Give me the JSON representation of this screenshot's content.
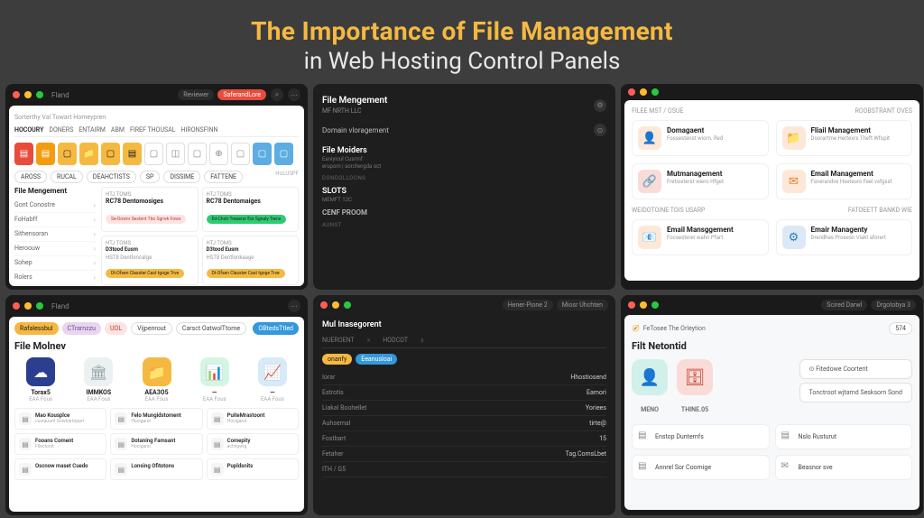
{
  "hero": {
    "title": "The Importance of File Management",
    "subtitle": "in Web Hosting Control Panels"
  },
  "p1": {
    "wintitle": "Fland",
    "btn1": "Reviewer",
    "btn2": "SaferandLore",
    "crumb": "Sorterthy Val Towart Homeypren",
    "tabs": [
      "HOCOURY",
      "DONERS",
      "ENTAIRM",
      "ABM",
      "FIREF THOUSAL",
      "HIRONSFINN"
    ],
    "filters": [
      "AROSS",
      "RUCAL",
      "DEAHCTISTS",
      "SP",
      "DISSIME",
      "FATTENE"
    ],
    "filter_r": "HULUSPF",
    "side_title": "File Mengement",
    "side_items": [
      "Gont Conostre",
      "FoHabff",
      "Sithensoran",
      "Heroouw",
      "Sohep",
      "Rolers"
    ],
    "cards": [
      {
        "t": "HTJ TOMS",
        "h": "RC78 Dentomosiges",
        "b": "Se-Downr Sestent Tbo Sgrwk Fows"
      },
      {
        "t": "HTJ TOMS",
        "h": "RC78 Dentomaiges",
        "b": "Ed-Chstr Treserur Eor Sgnaly Trens"
      },
      {
        "t": "HTJ TOMS",
        "h": "D3tood Eusm",
        "b": "Dt-Ofsen Classter Cast tgoge Trve",
        "s": "HST8 Dentloncalge"
      },
      {
        "t": "HTJ TOMS",
        "h": "D3tood Eusm",
        "b": "Dt-Ofsen Classter Cast tgoge Trve",
        "s": "HST8 Dentlonkaage"
      }
    ]
  },
  "p2": {
    "title": "File Mengement",
    "sub1": "MF NRTH LLC",
    "item1": "Domain vloragement",
    "sec": {
      "title": "File Moiders",
      "sub": "Eaniyicul Cusrmf",
      "sub2": "eruporn | sorchergda oct"
    },
    "div1": "DONDOLLOONS",
    "s2": "SLOTS",
    "s2s": "MEMFT 12C",
    "div2": "CENF PROOM",
    "s3": "AUNST"
  },
  "p3": {
    "hdr_l": "FILEE MST / OSUE",
    "hdr_r": "ROOBSTRANT OVES",
    "hdr_m": "WEIDOTOINE TOIS USARP",
    "hdr_m2": "FATOEETT BANKD WIE",
    "cards": [
      {
        "i": "or",
        "t": "Domagaent",
        "s": "Fossestenst wiorn. Red"
      },
      {
        "i": "or",
        "t": "Fliail Management",
        "s": "Doorartme Hertexrs Theft Wfopit"
      },
      {
        "i": "pk",
        "t": "Mutmanagement",
        "s": "Fretiosterst wiero Hfget"
      },
      {
        "i": "or",
        "t": "Email Management",
        "s": "Fsnerandve Hseteurs Feel vsfgsst"
      },
      {
        "i": "or",
        "t": "Email Mansggement",
        "s": "Focsesterer wahn Pfart"
      },
      {
        "i": "bl",
        "t": "Emair Managenty",
        "s": "Drendhes Prosesn Viakt aforert"
      }
    ]
  },
  "p4": {
    "wintitle": "Fland",
    "chips": [
      "Rafalessbul",
      "CTrarnzzu",
      "UOL",
      "Vijpenrout",
      "Carsct OatwolTtome"
    ],
    "chip_r": "OBtedsTtled",
    "title": "File Molnev",
    "big": [
      {
        "i": "bl",
        "t": "Torax5",
        "s": "EAA Fous"
      },
      {
        "i": "gy",
        "t": "IMMKOS",
        "s": "EAA Fous"
      },
      {
        "i": "yl",
        "t": "AEA3O5",
        "s": "EAA Fous"
      },
      {
        "i": "gn",
        "t": "—",
        "s": "EAA Fous"
      },
      {
        "i": "lb",
        "t": "—",
        "s": "EAA Fous"
      }
    ],
    "small": [
      {
        "t": "Mao Kousplce",
        "s": "custauarit Gowhartopart"
      },
      {
        "t": "Felo Mungidstoment",
        "s": "Hocigarst"
      },
      {
        "t": "PuiteMrastoont",
        "s": "Hocigarst"
      },
      {
        "t": "Fooans Coment",
        "s": "Filectorst"
      },
      {
        "t": "Dotaning Famsant",
        "s": "Hocigarst"
      },
      {
        "t": "Comepity",
        "s": "actvigwrg"
      },
      {
        "t": "Oscnow maset Cuedo",
        "s": ""
      },
      {
        "t": "Lonsing Ofitotons",
        "s": ""
      },
      {
        "t": "Pupldsnits",
        "s": ""
      }
    ]
  },
  "p5": {
    "btn_l": "Hener-Pione 2",
    "btn_r": "Miosr Uhchten",
    "title": "Mul Inasegorent",
    "tabs": [
      "NUEROENT",
      "x",
      "HODCOT",
      "x"
    ],
    "b1": "onanfy",
    "b2": "Eeanusloai",
    "kv": [
      {
        "k": "Iorar",
        "v": "Hhostiosend"
      },
      {
        "k": "Estrotis",
        "v": "Eamori"
      },
      {
        "k": "Liakal Boohellet",
        "v": "Yoriees"
      },
      {
        "k": "Auhsernal",
        "v": "tirte@"
      },
      {
        "k": "Fostbart",
        "v": "15"
      },
      {
        "k": "Fetaher",
        "v": "Tag.ComsLbet"
      },
      {
        "k": "ITH / G5",
        "v": ""
      }
    ]
  },
  "p6": {
    "btn1": "Scired Darwl",
    "btn2": "Drgotobya 3",
    "crumb": "FeTosee The Orleytion",
    "badge": "574",
    "title": "Filt Netontid",
    "act1": "MENO",
    "act2": "THINE.05",
    "side1": "⊙ Fitedowe Coorterit",
    "side2": "Tonctroot wjtarnd Sesksorn Sond",
    "grid": [
      "Enstop Duntemfs",
      "Nslo Rusturut",
      "Annrel Sor Coomige",
      "Beasnor sve"
    ]
  }
}
